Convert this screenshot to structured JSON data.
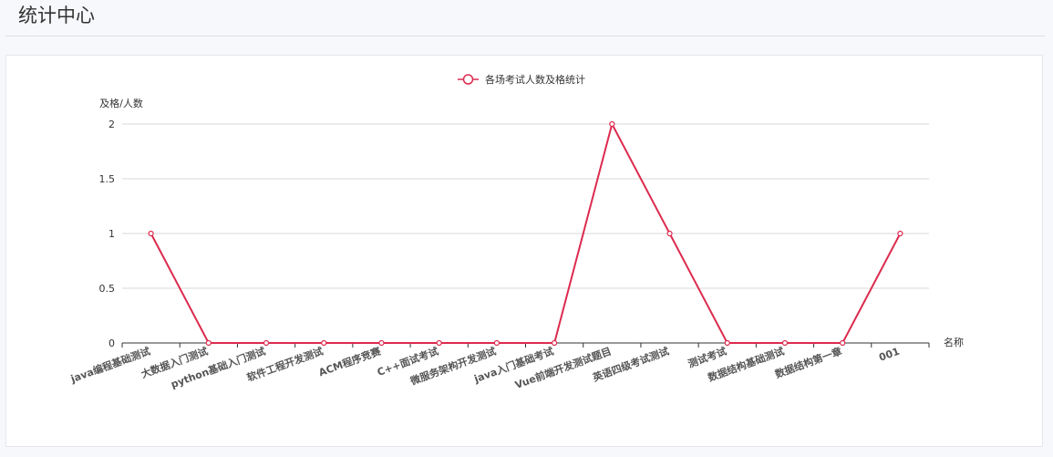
{
  "page": {
    "title": "统计中心"
  },
  "colors": {
    "series": "#dc2b4e",
    "grid": "#d9d9d9",
    "axis": "#333333"
  },
  "chart_data": {
    "type": "line",
    "title": "",
    "xlabel": "名称",
    "ylabel": "及格/人数",
    "ylim": [
      0,
      2
    ],
    "yticks": [
      0,
      0.5,
      1,
      1.5,
      2
    ],
    "ytick_labels": [
      "0",
      "0.5",
      "1",
      "1.5",
      "2"
    ],
    "categories": [
      "java编程基础测试",
      "大数据入门测试",
      "python基础入门测试",
      "软件工程开发测试",
      "ACM程序竞赛",
      "C++面试考试",
      "微服务架构开发测试",
      "java入门基础考试",
      "Vue前端开发测试题目",
      "英语四级考试测试",
      "测试考试",
      "数据结构基础测试",
      "数据结构第一章",
      "001"
    ],
    "series": [
      {
        "name": "各场考试人数及格统计",
        "values": [
          1,
          0,
          0,
          0,
          0,
          0,
          0,
          0,
          2,
          1,
          0,
          0,
          0,
          1
        ]
      }
    ],
    "grid": true,
    "legend": "top-center"
  }
}
